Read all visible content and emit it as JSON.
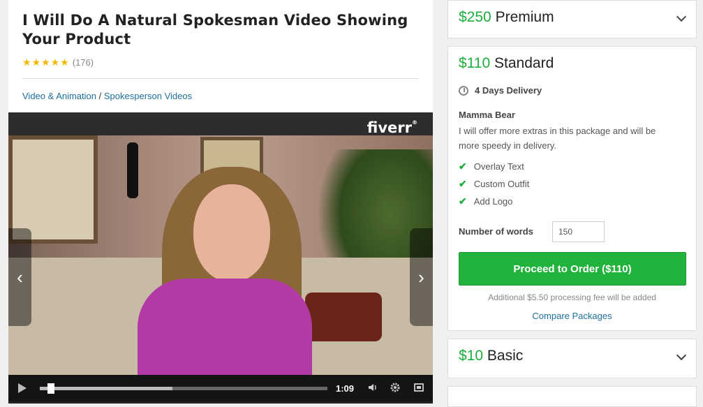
{
  "gig": {
    "title": "I Will Do A Natural Spokesman Video Showing Your Product",
    "stars": "★★★★★",
    "review_count": "(176)",
    "rating": 5,
    "breadcrumb": {
      "category": "Video & Animation",
      "separator": "/",
      "subcategory": "Spokesperson Videos"
    }
  },
  "video": {
    "logo": "fiverr",
    "logo_mark": "®",
    "prev_arrow": "‹",
    "next_arrow": "›",
    "duration": "1:09",
    "buffered_fraction": 0.46,
    "played_fraction": 0.02,
    "icons": [
      "play-icon",
      "volume-icon",
      "gear-icon",
      "fullscreen-icon"
    ]
  },
  "packages": {
    "premium": {
      "price": "$250",
      "name": "Premium"
    },
    "standard": {
      "price": "$110",
      "name": "Standard",
      "delivery": "4 Days Delivery",
      "package_name": "Mamma Bear",
      "description": "I will offer more extras in this package and will be more speedy in delivery.",
      "features": [
        "Overlay Text",
        "Custom Outfit",
        "Add Logo"
      ],
      "words_label": "Number of words",
      "words_value": "150",
      "order_button": "Proceed to Order ($110)",
      "fee_note": "Additional $5.50 processing fee will be added",
      "compare_link": "Compare Packages"
    },
    "basic": {
      "price": "$10",
      "name": "Basic"
    }
  },
  "colors": {
    "price_green": "#1dae3d",
    "button_green": "#21b33b",
    "link_blue": "#1d6f9b",
    "star_gold": "#f5b700"
  }
}
